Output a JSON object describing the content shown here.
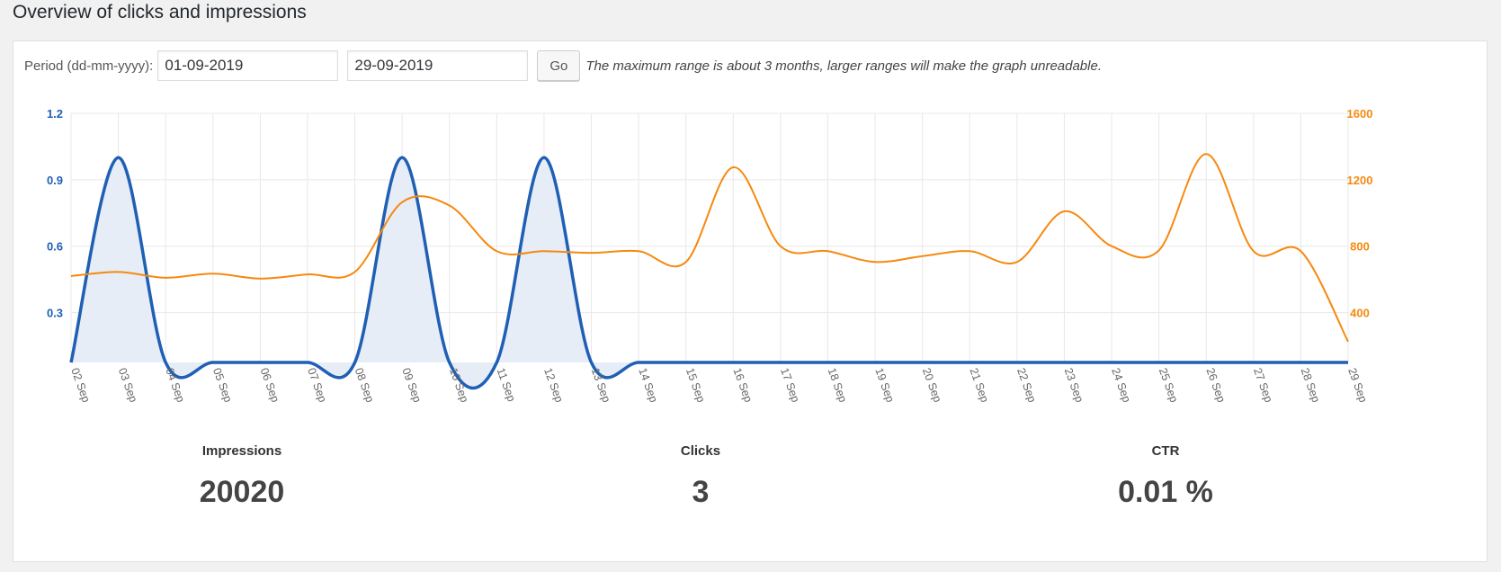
{
  "header": {
    "title": "Overview of clicks and impressions"
  },
  "filter": {
    "period_label": "Period (dd-mm-yyyy):",
    "start_date": "01-09-2019",
    "end_date": "29-09-2019",
    "go_label": "Go",
    "note": "The maximum range is about 3 months, larger ranges will make the graph unreadable."
  },
  "colors": {
    "clicks": "#1f5fb4",
    "impressions": "#f6890f",
    "clicks_fill": "#e6edf7"
  },
  "chart_data": {
    "type": "line",
    "title": "",
    "categories": [
      "02 Sep",
      "03 Sep",
      "04 Sep",
      "05 Sep",
      "06 Sep",
      "07 Sep",
      "08 Sep",
      "09 Sep",
      "10 Sep",
      "11 Sep",
      "12 Sep",
      "13 Sep",
      "14 Sep",
      "15 Sep",
      "16 Sep",
      "17 Sep",
      "18 Sep",
      "19 Sep",
      "20 Sep",
      "21 Sep",
      "22 Sep",
      "23 Sep",
      "24 Sep",
      "25 Sep",
      "26 Sep",
      "27 Sep",
      "28 Sep",
      "29 Sep"
    ],
    "series": [
      {
        "axis": "left",
        "area": true,
        "values": [
          0,
          1,
          0,
          0,
          0,
          0,
          0,
          1,
          0,
          0,
          1,
          0,
          0,
          0,
          0,
          0,
          0,
          0,
          0,
          0,
          0,
          0,
          0,
          0,
          0,
          0,
          0,
          0
        ]
      },
      {
        "axis": "right",
        "area": false,
        "values": [
          620,
          645,
          610,
          635,
          605,
          630,
          645,
          1065,
          1045,
          770,
          770,
          760,
          770,
          705,
          1275,
          800,
          770,
          705,
          740,
          770,
          705,
          1010,
          800,
          775,
          1355,
          770,
          770,
          225
        ]
      }
    ],
    "y_left": {
      "ticks": [
        0.3,
        0.6,
        0.9,
        1.2
      ],
      "tick_labels": [
        "0.3",
        "0.6",
        "0.9",
        "1.2"
      ],
      "min": 0.075,
      "max": 1.2
    },
    "y_right": {
      "ticks": [
        400,
        800,
        1200,
        1600
      ],
      "tick_labels": [
        "400",
        "800",
        "1200",
        "1600"
      ],
      "min": 100,
      "max": 1600
    },
    "grid": true
  },
  "stats": [
    {
      "label": "Impressions",
      "value": "20020"
    },
    {
      "label": "Clicks",
      "value": "3"
    },
    {
      "label": "CTR",
      "value": "0.01 %"
    }
  ]
}
